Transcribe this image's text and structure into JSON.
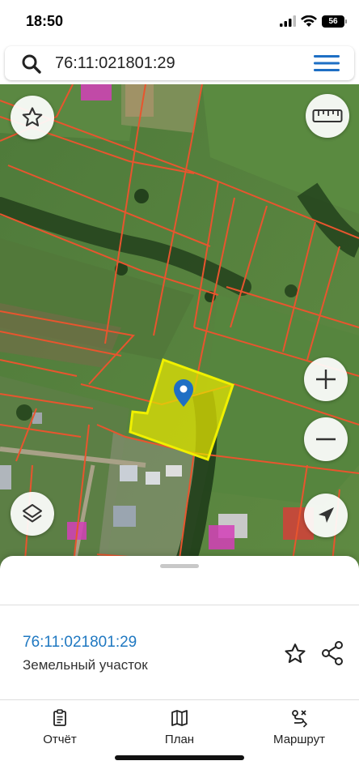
{
  "status_bar": {
    "time": "18:50",
    "battery": "56",
    "icons": [
      "signal-icon",
      "wifi-icon",
      "battery-icon"
    ]
  },
  "search": {
    "value": "76:11:021801:29",
    "icon": "search-icon",
    "menu_icon": "hamburger-menu-icon"
  },
  "map": {
    "controls": [
      "star-icon",
      "ruler-icon",
      "zoom-in-icon",
      "zoom-out-icon",
      "layers-icon",
      "navigation-arrow-icon",
      "location-pin-icon"
    ],
    "parcel_fill": "#e6e600",
    "parcel_stroke": "#f0f000",
    "boundary_color": "#e8552e",
    "building_marker_color": "#d43fb8",
    "pin_color": "#1e6fc4"
  },
  "sheet": {
    "parcel_number": "76:11:021801:29",
    "parcel_type": "Земельный участок",
    "number_color": "#1f78c1"
  },
  "bottom_nav": {
    "items": [
      {
        "label": "Отчёт",
        "icon": "report-clipboard-icon"
      },
      {
        "label": "План",
        "icon": "map-plan-icon"
      },
      {
        "label": "Маршрут",
        "icon": "route-icon"
      }
    ]
  }
}
